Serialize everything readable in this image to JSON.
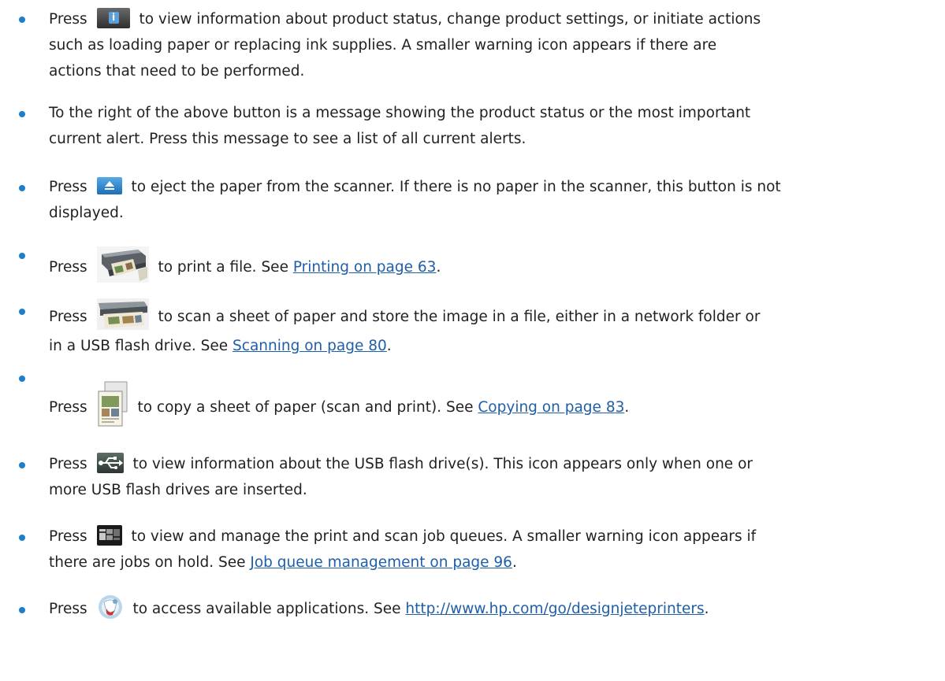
{
  "bullets": [
    {
      "icon": "info-button-icon",
      "before": "Press",
      "line1_after": "to view information about product status, change product settings, or initiate actions",
      "line2": "such as loading paper or replacing ink supplies. A smaller warning icon appears if there are",
      "line3": "actions that need to be performed."
    },
    {
      "line1": "To the right of the above button is a message showing the product status or the most important",
      "line2": "current alert. Press this message to see a list of all current alerts."
    },
    {
      "icon": "eject-button-icon",
      "before": "Press",
      "line1_after": "to eject the paper from the scanner. If there is no paper in the scanner, this button is not",
      "line2": "displayed."
    },
    {
      "icon": "print-icon",
      "before": "Press",
      "after": "to print a file. See",
      "link": "Printing on page 63",
      "end": "."
    },
    {
      "icon": "scan-icon",
      "before": "Press",
      "line1_after": "to scan a sheet of paper and store the image in a file, either in a network folder or",
      "line2_before": "in a USB flash drive. See",
      "link": "Scanning on page 80",
      "end": "."
    },
    {
      "icon": "copy-icon",
      "before": "Press",
      "after": "to copy a sheet of paper (scan and print). See",
      "link": "Copying on page 83",
      "end": "."
    },
    {
      "icon": "usb-icon",
      "before": "Press",
      "line1_after": "to view information about the USB flash drive(s). This icon appears only when one or",
      "line2": "more USB flash drives are inserted."
    },
    {
      "icon": "job-queue-icon",
      "before": "Press",
      "line1_after": "to view and manage the print and scan job queues. A smaller warning icon appears if",
      "line2_before": "there are jobs on hold. See",
      "link": "Job queue management on page 96",
      "end": "."
    },
    {
      "icon": "applications-icon",
      "before": "Press",
      "after": "to access available applications. See",
      "link": "http://www.hp.com/go/designjeteprinters",
      "end": "."
    }
  ],
  "colors": {
    "bullet": "#1e7ec8",
    "link": "#1f5ea8",
    "text": "#231f20"
  }
}
